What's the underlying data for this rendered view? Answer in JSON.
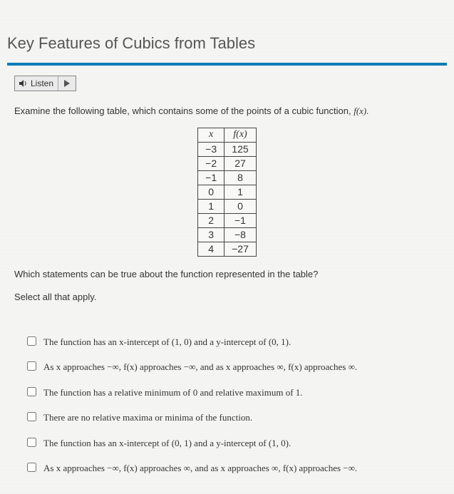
{
  "title": "Key Features of Cubics from Tables",
  "listen": {
    "label": "Listen"
  },
  "prompt_prefix": "Examine the following table, which contains some of the points of a cubic function, ",
  "prompt_func": "f(x).",
  "table": {
    "head_x": "x",
    "head_fx": "f(x)",
    "rows": [
      {
        "x": "−3",
        "fx": "125"
      },
      {
        "x": "−2",
        "fx": "27"
      },
      {
        "x": "−1",
        "fx": "8"
      },
      {
        "x": "0",
        "fx": "1"
      },
      {
        "x": "1",
        "fx": "0"
      },
      {
        "x": "2",
        "fx": "−1"
      },
      {
        "x": "3",
        "fx": "−8"
      },
      {
        "x": "4",
        "fx": "−27"
      }
    ]
  },
  "question": {
    "line1": "Which statements can be true about the function represented in the table?",
    "line2": "Select all that apply."
  },
  "options": [
    "The function has an x-intercept of (1, 0) and a y-intercept of (0, 1).",
    "As x approaches −∞, f(x) approaches −∞, and as x approaches ∞, f(x) approaches ∞.",
    "The function has a relative minimum of 0 and relative maximum of 1.",
    "There are no relative maxima or minima of the function.",
    "The function has an x-intercept of (0, 1) and a y-intercept of (1, 0).",
    "As x approaches −∞, f(x) approaches ∞, and as x approaches ∞, f(x) approaches −∞."
  ],
  "chart_data": {
    "type": "table",
    "columns": [
      "x",
      "f(x)"
    ],
    "rows": [
      [
        -3,
        125
      ],
      [
        -2,
        27
      ],
      [
        -1,
        8
      ],
      [
        0,
        1
      ],
      [
        1,
        0
      ],
      [
        2,
        -1
      ],
      [
        3,
        -8
      ],
      [
        4,
        -27
      ]
    ]
  }
}
